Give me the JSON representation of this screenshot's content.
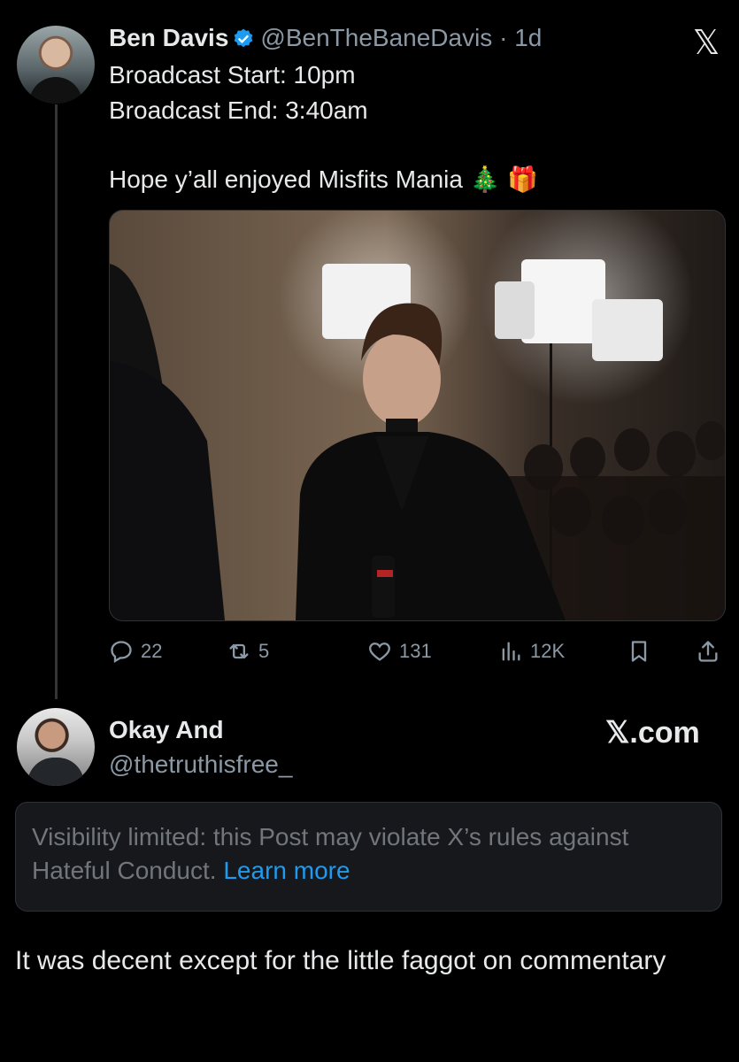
{
  "tweet": {
    "author_name": "Ben Davis",
    "author_handle": "@BenTheBaneDavis",
    "time": " · 1d",
    "lines": [
      "Broadcast Start: 10pm",
      "Broadcast End: 3:40am"
    ],
    "message": "Hope y’all enjoyed Misfits Mania 🎄 🎁",
    "stats": {
      "replies": "22",
      "retweets": "5",
      "likes": "131",
      "views": "12K"
    }
  },
  "reply": {
    "author_name": "Okay And",
    "author_handle": "@thetruthisfree_",
    "watermark": "𝕏.com",
    "notice_text": "Visibility limited: this Post may violate X’s rules against Hateful Conduct.",
    "notice_link": "Learn more",
    "body": "It was decent except for the little faggot on commentary"
  },
  "colors": {
    "background": "#000000",
    "text": "#e7e9ea",
    "muted": "#8b98a5",
    "link": "#1d9bf0",
    "verified": "#1d9bf0"
  },
  "icons": [
    "close-x-icon",
    "verified-badge-icon",
    "reply-icon",
    "retweet-icon",
    "like-icon",
    "views-icon",
    "bookmark-icon",
    "share-icon"
  ]
}
